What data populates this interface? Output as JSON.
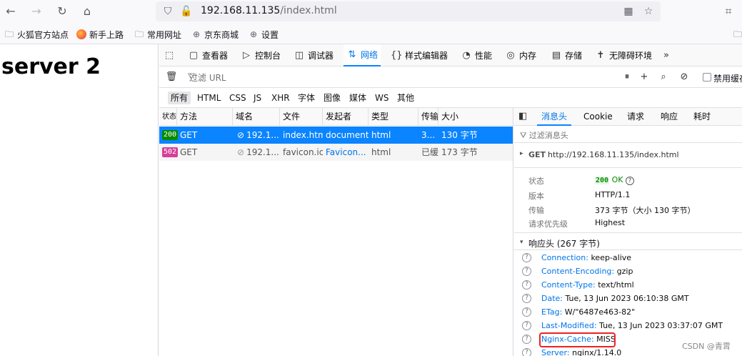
{
  "browser": {
    "url_host": "192.168.11.135",
    "url_path": "/index.html",
    "bookmarks": [
      "火狐官方站点",
      "新手上路",
      "常用网址",
      "京东商城",
      "设置"
    ]
  },
  "page": {
    "heading": "server 2"
  },
  "devtools": {
    "tabs": [
      "查看器",
      "控制台",
      "调试器",
      "网络",
      "样式编辑器",
      "性能",
      "内存",
      "存储",
      "无障碍环境"
    ],
    "filter_placeholder": "过滤 URL",
    "disable_cache_label": "禁用缓存",
    "type_filters": [
      "所有",
      "HTML",
      "CSS",
      "JS",
      "XHR",
      "字体",
      "图像",
      "媒体",
      "WS",
      "其他"
    ],
    "columns": [
      "状态",
      "方法",
      "域名",
      "文件",
      "发起者",
      "类型",
      "传输",
      "大小"
    ],
    "requests": [
      {
        "status": "200",
        "method": "GET",
        "domain": "192.1...",
        "file": "index.htm",
        "initiator": "document",
        "type": "html",
        "transfer": "3...",
        "size": "130 字节"
      },
      {
        "status": "502",
        "method": "GET",
        "domain": "192.1...",
        "file": "favicon.ico",
        "initiator": "Favicon...",
        "type": "html",
        "transfer": "已缓存",
        "size": "173 字节"
      }
    ],
    "sidebar": {
      "tabs": [
        "消息头",
        "Cookie",
        "请求",
        "响应",
        "耗时"
      ],
      "filter_placeholder": "过滤消息头",
      "request_method": "GET",
      "request_url": "http://192.168.11.135/index.html",
      "summary": {
        "status_label": "状态",
        "status_code": "200",
        "status_text": "OK",
        "version_label": "版本",
        "version": "HTTP/1.1",
        "transfer_label": "传输",
        "transfer": "373 字节（大小 130 字节）",
        "priority_label": "请求优先级",
        "priority": "Highest"
      },
      "response_headers_title": "响应头 (267 字节)",
      "response_headers": [
        {
          "name": "Connection:",
          "value": "keep-alive"
        },
        {
          "name": "Content-Encoding:",
          "value": "gzip"
        },
        {
          "name": "Content-Type:",
          "value": "text/html"
        },
        {
          "name": "Date:",
          "value": "Tue, 13 Jun 2023 06:10:38 GMT"
        },
        {
          "name": "ETag:",
          "value": "W/\"6487e463-82\""
        },
        {
          "name": "Last-Modified:",
          "value": "Tue, 13 Jun 2023 03:37:07 GMT"
        },
        {
          "name": "Nginx-Cache:",
          "value": "MISS"
        },
        {
          "name": "Server:",
          "value": "nginx/1.14.0"
        }
      ]
    }
  },
  "watermark": "CSDN @青霄",
  "colors": {
    "accent": "#0a84ff",
    "ok": "#058b00",
    "err_badge": "#d63f9a",
    "highlight": "#e22222"
  }
}
